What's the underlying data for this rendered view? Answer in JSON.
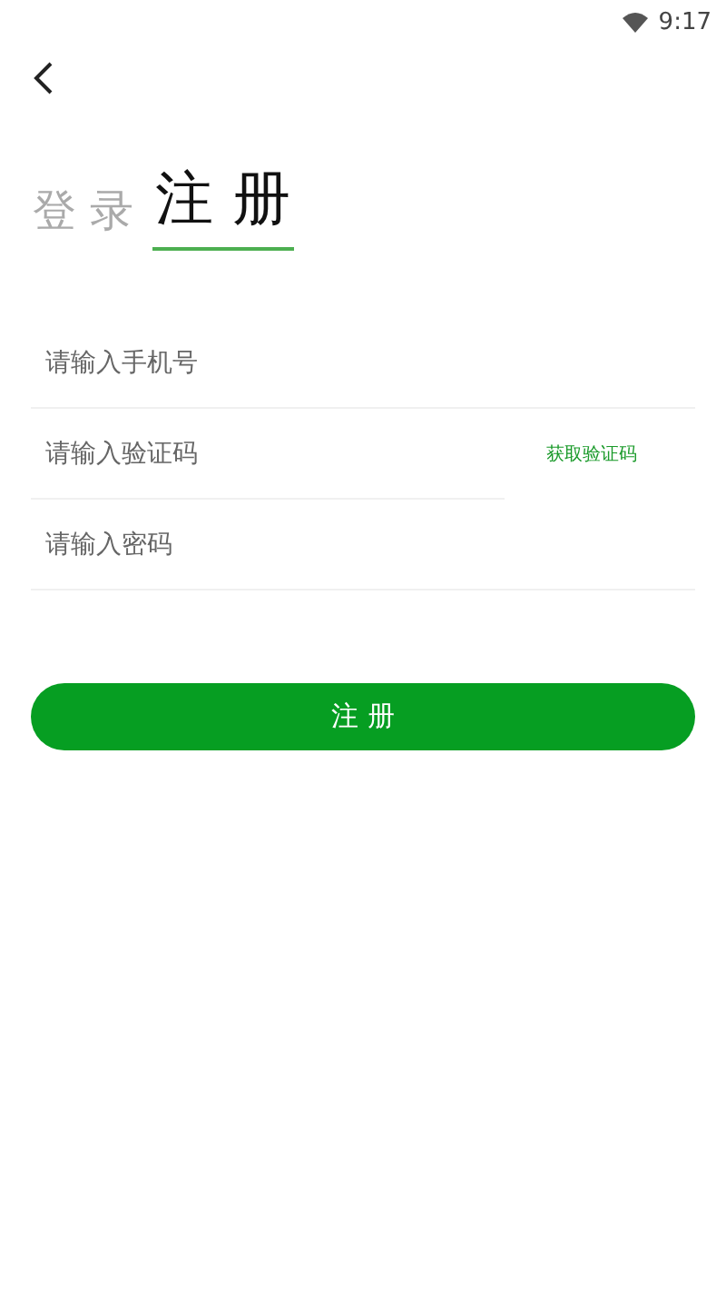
{
  "status_bar": {
    "time": "9:17"
  },
  "tabs": [
    {
      "label": "登 录",
      "selected": false
    },
    {
      "label": "注 册",
      "selected": true
    }
  ],
  "fields": [
    {
      "placeholder": "请输入手机号"
    },
    {
      "placeholder": "请输入验证码",
      "action": "获取验证码"
    },
    {
      "placeholder": "请输入密码"
    }
  ],
  "submit_button": "注 册"
}
